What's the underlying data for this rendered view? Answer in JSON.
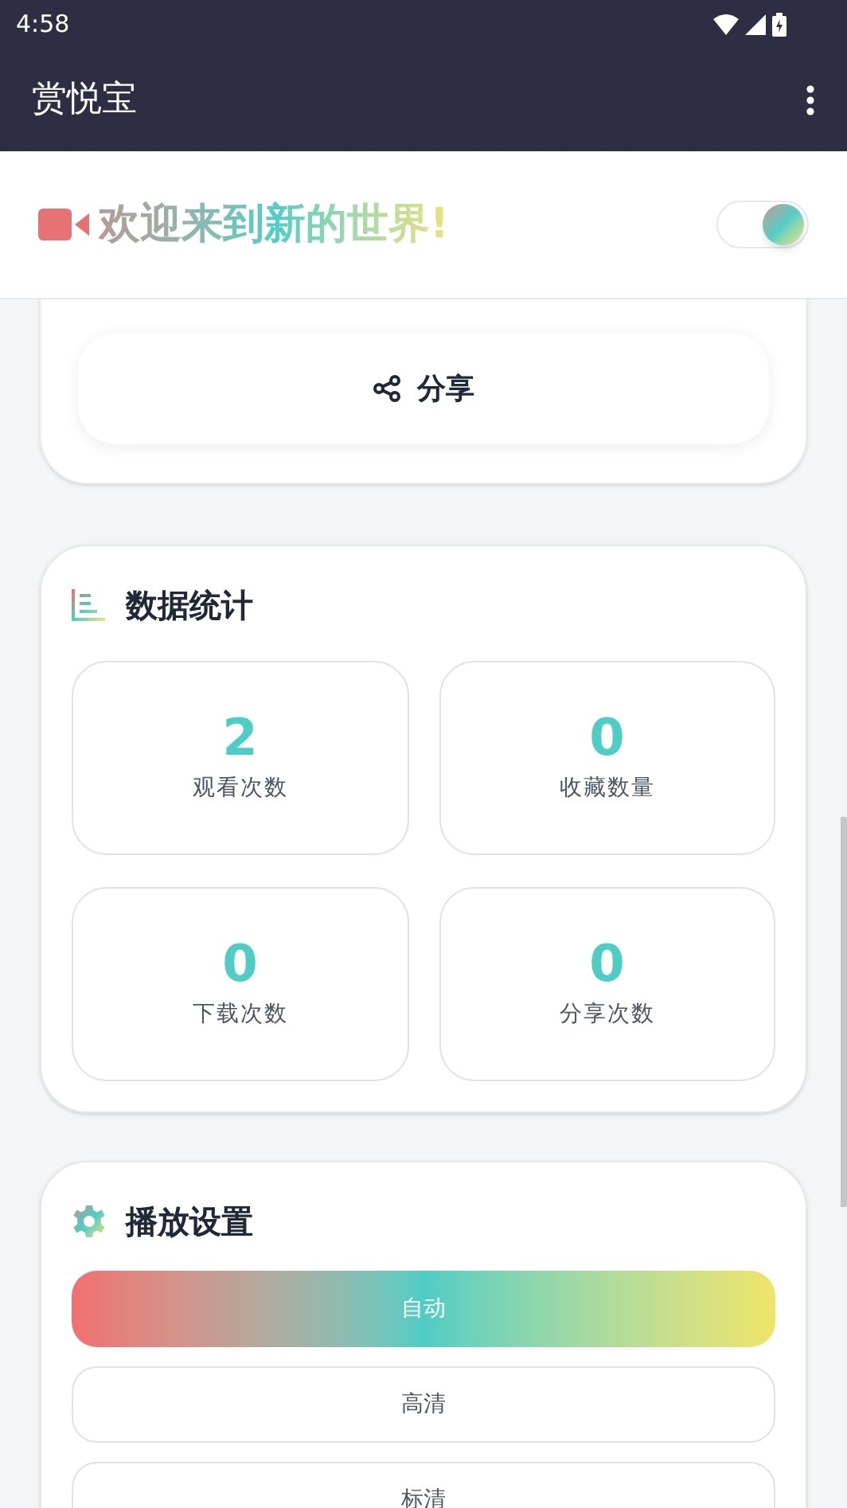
{
  "status_bar": {
    "time": "4:58"
  },
  "app_bar": {
    "title": "赏悦宝"
  },
  "header": {
    "welcome": "欢迎来到新的世界!",
    "toggle": {
      "on": true
    }
  },
  "share_button": {
    "label": "分享"
  },
  "stats": {
    "title": "数据统计",
    "items": [
      {
        "value": "2",
        "label": "观看次数"
      },
      {
        "value": "0",
        "label": "收藏数量"
      },
      {
        "value": "0",
        "label": "下载次数"
      },
      {
        "value": "0",
        "label": "分享次数"
      }
    ]
  },
  "playback": {
    "title": "播放设置",
    "options": [
      {
        "label": "自动",
        "selected": true
      },
      {
        "label": "高清",
        "selected": false
      },
      {
        "label": "标清",
        "selected": false
      }
    ]
  }
}
